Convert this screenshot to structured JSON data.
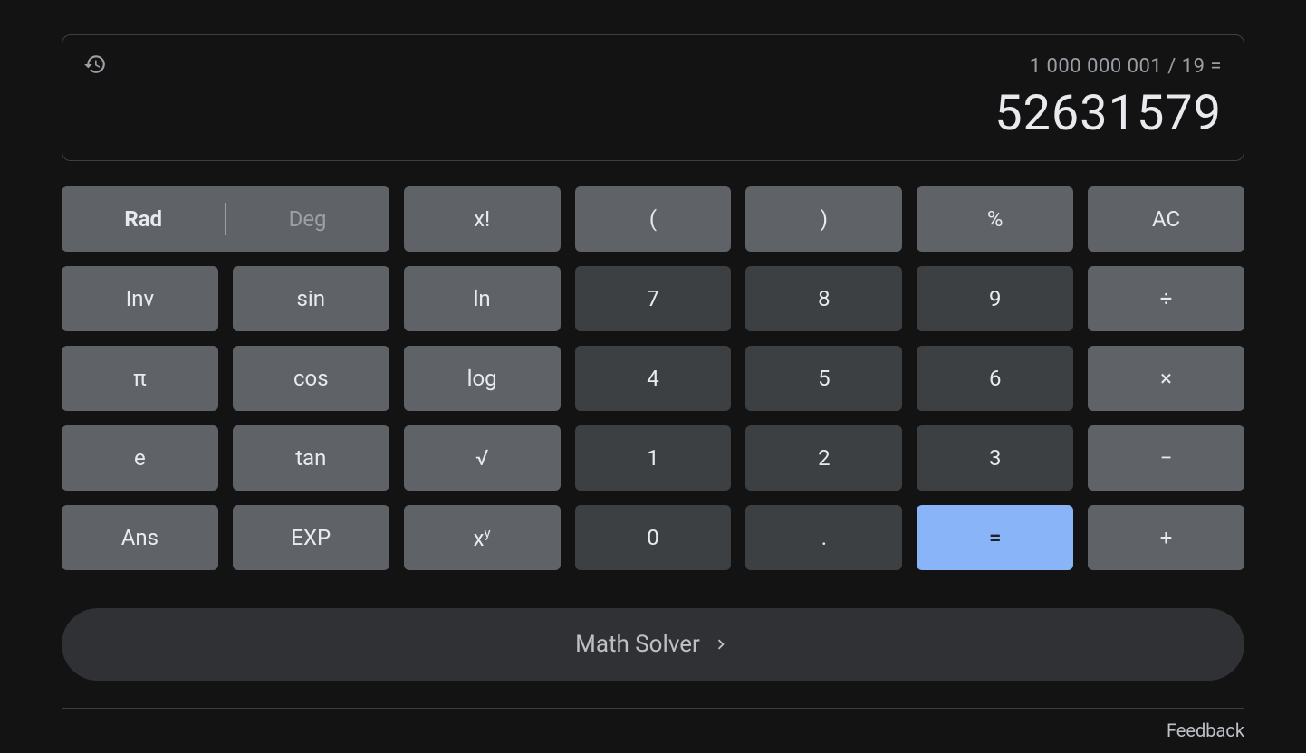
{
  "display": {
    "expression": "1 000 000 001 / 19 =",
    "result": "52631579"
  },
  "angle_mode": {
    "rad": "Rad",
    "deg": "Deg"
  },
  "buttons": {
    "factorial": "x!",
    "lparen": "(",
    "rparen": ")",
    "percent": "%",
    "ac": "AC",
    "inv": "Inv",
    "sin": "sin",
    "ln": "ln",
    "seven": "7",
    "eight": "8",
    "nine": "9",
    "divide": "÷",
    "pi": "π",
    "cos": "cos",
    "log": "log",
    "four": "4",
    "five": "5",
    "six": "6",
    "multiply": "×",
    "e": "e",
    "tan": "tan",
    "sqrt": "√",
    "one": "1",
    "two": "2",
    "three": "3",
    "minus": "−",
    "ans": "Ans",
    "exp": "EXP",
    "xy_base": "x",
    "xy_exp": "y",
    "zero": "0",
    "dot": ".",
    "equals": "=",
    "plus": "+"
  },
  "math_solver": "Math Solver",
  "feedback": "Feedback"
}
